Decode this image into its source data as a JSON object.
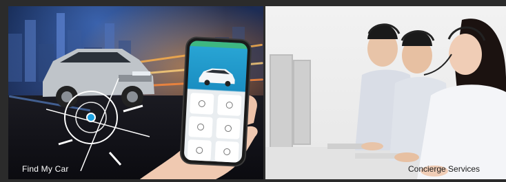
{
  "tiles": [
    {
      "caption": "Find My Car"
    },
    {
      "caption": "Concierge Services"
    }
  ],
  "colors": {
    "location_dot": "#1da0e0",
    "app_header": "#1a8ec2"
  }
}
